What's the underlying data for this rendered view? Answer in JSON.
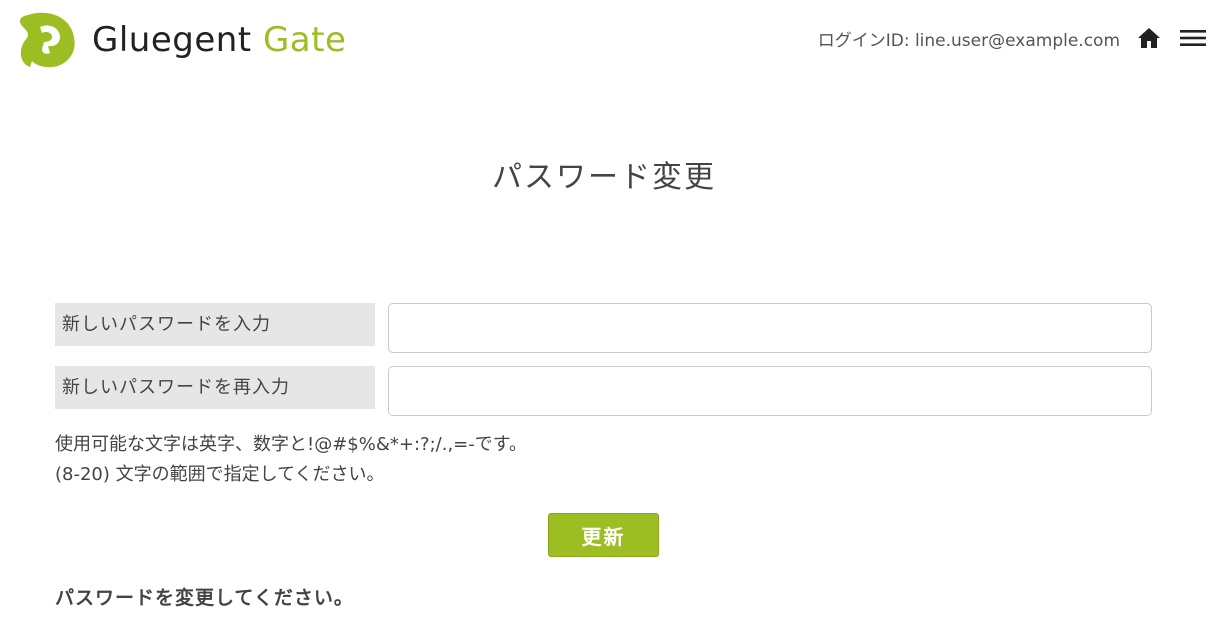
{
  "header": {
    "logo_word1": "Gluegent",
    "logo_word2": "Gate",
    "login_id": "ログインID: line.user@example.com",
    "home_icon": "home-icon",
    "menu_icon": "hamburger-menu-icon"
  },
  "colors": {
    "brand_green": "#9cbe22",
    "label_bg": "#e6e6e6",
    "text": "#444444"
  },
  "main": {
    "title": "パスワード変更",
    "new_password_label": "新しいパスワードを入力",
    "new_password_value": "",
    "confirm_password_label": "新しいパスワードを再入力",
    "confirm_password_value": "",
    "hint_line1": "使用可能な文字は英字、数字と!@#$%&*+:?;/.,=-です。",
    "hint_line2": "(8-20) 文字の範囲で指定してください。",
    "submit_label": "更新",
    "message": "パスワードを変更してください。"
  }
}
